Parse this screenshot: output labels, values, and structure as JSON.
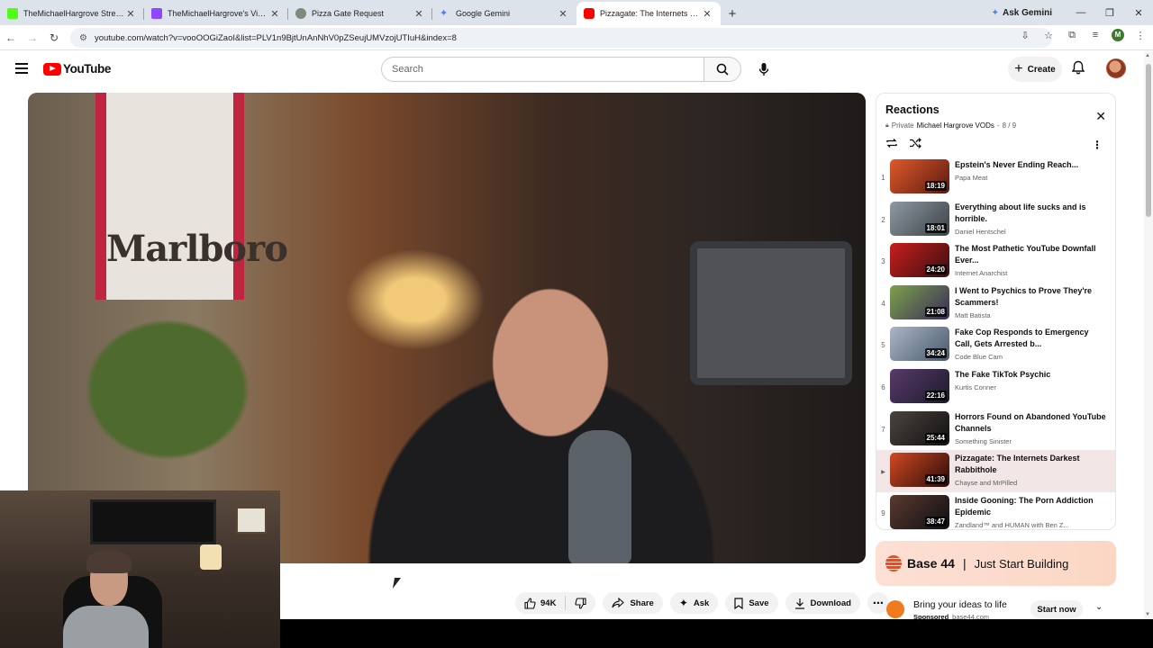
{
  "browser": {
    "tabs": [
      {
        "title": "TheMichaelHargrove Stream - V",
        "color": "#53fc18"
      },
      {
        "title": "TheMichaelHargrove's Videos -",
        "color": "#9146ff"
      },
      {
        "title": "Pizza Gate Request",
        "color": "#7d8b7a"
      },
      {
        "title": "Google Gemini",
        "color": "#4f7df5"
      },
      {
        "title": "Pizzagate: The Internets Darkest",
        "color": "#ff0000"
      }
    ],
    "ask_gemini": "Ask Gemini",
    "url": "youtube.com/watch?v=vooOOGiZaoI&list=PLV1n9BjtUnAnNhV0pZSeujUMVzojUTIuH&index=8",
    "profile_initial": "M"
  },
  "youtube": {
    "logo_text": "YouTube",
    "search_placeholder": "Search",
    "create_label": "Create"
  },
  "video": {
    "poster_text": "Marlboro"
  },
  "actions": {
    "likes": "94K",
    "share": "Share",
    "ask": "Ask",
    "save": "Save",
    "download": "Download"
  },
  "playlist": {
    "title": "Reactions",
    "visibility": "Private",
    "channel": "Michael Hargrove VODs",
    "position": "8 / 9",
    "items": [
      {
        "index": "1",
        "title": "Epstein's Never Ending Reach...",
        "channel": "Papa Meat",
        "duration": "18:19",
        "thumb": "#8a2a18"
      },
      {
        "index": "2",
        "title": "Everything about life sucks and is horrible.",
        "channel": "Daniel Hentschel",
        "duration": "18:01",
        "thumb": "#5a6670"
      },
      {
        "index": "3",
        "title": "The Most Pathetic YouTube Downfall Ever...",
        "channel": "Internet Anarchist",
        "duration": "24:20",
        "thumb": "#b21e1e"
      },
      {
        "index": "4",
        "title": "I Went to Psychics to Prove They're Scammers!",
        "channel": "Matt Batista",
        "duration": "21:08",
        "thumb": "#5c7a3a"
      },
      {
        "index": "5",
        "title": "Fake Cop Responds to Emergency Call, Gets Arrested b...",
        "channel": "Code Blue Cam",
        "duration": "34:24",
        "thumb": "#7a8aa0"
      },
      {
        "index": "6",
        "title": "The Fake TikTok Psychic",
        "channel": "Kurtis Conner",
        "duration": "22:16",
        "thumb": "#3a2a4a"
      },
      {
        "index": "7",
        "title": "Horrors Found on Abandoned YouTube Channels",
        "channel": "Something Sinister",
        "duration": "25:44",
        "thumb": "#2a2624"
      },
      {
        "index": "▶",
        "title": "Pizzagate: The Internets Darkest Rabbithole",
        "channel": "Chayse and MrPilled",
        "duration": "41:39",
        "thumb": "#6a2418",
        "active": true
      },
      {
        "index": "9",
        "title": "Inside Gooning: The Porn Addiction Epidemic",
        "channel": "Zandland™ and HUMAN with Ben Z...",
        "duration": "38:47",
        "thumb": "#1e1e22"
      }
    ]
  },
  "ad": {
    "brand": "Base 44",
    "divider": "|",
    "tagline": "Just Start Building",
    "headline": "Bring your ideas to life",
    "sponsored": "Sponsored",
    "domain": "base44.com",
    "cta": "Start now"
  }
}
